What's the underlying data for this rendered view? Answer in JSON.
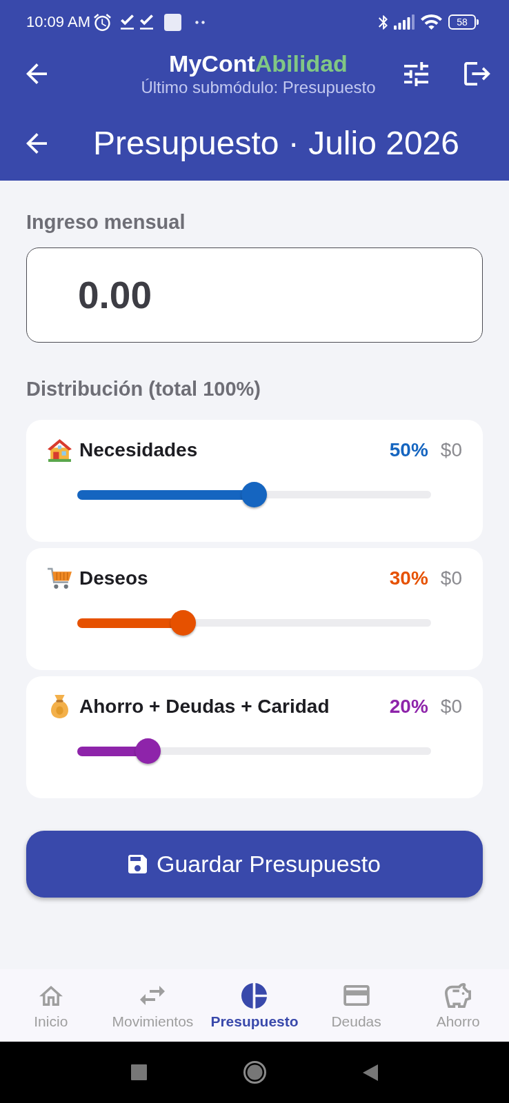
{
  "status_bar": {
    "time": "10:09 AM",
    "battery": "58"
  },
  "app_bar": {
    "title": {
      "main": "MyCont",
      "accent": "Abilidad"
    },
    "subtitle": "Último submódulo: Presupuesto"
  },
  "page_header": {
    "title": "Presupuesto · Julio 2026"
  },
  "income": {
    "label": "Ingreso mensual",
    "value": "0.00"
  },
  "distribution": {
    "heading": "Distribución (total 100%)",
    "categories": [
      {
        "name": "Necesidades",
        "percent": "50%",
        "amount": "$0",
        "level": 0.5,
        "color": "#1565c0"
      },
      {
        "name": "Deseos",
        "percent": "30%",
        "amount": "$0",
        "level": 0.3,
        "color": "#e65100"
      },
      {
        "name": "Ahorro + Deudas + Caridad",
        "percent": "20%",
        "amount": "$0",
        "level": 0.2,
        "color": "#8e24aa"
      }
    ]
  },
  "save_button": {
    "label": "Guardar Presupuesto"
  },
  "bottom_nav": [
    {
      "label": "Inicio",
      "selected": false
    },
    {
      "label": "Movimientos",
      "selected": false
    },
    {
      "label": "Presupuesto",
      "selected": true
    },
    {
      "label": "Deudas",
      "selected": false
    },
    {
      "label": "Ahorro",
      "selected": false
    }
  ]
}
